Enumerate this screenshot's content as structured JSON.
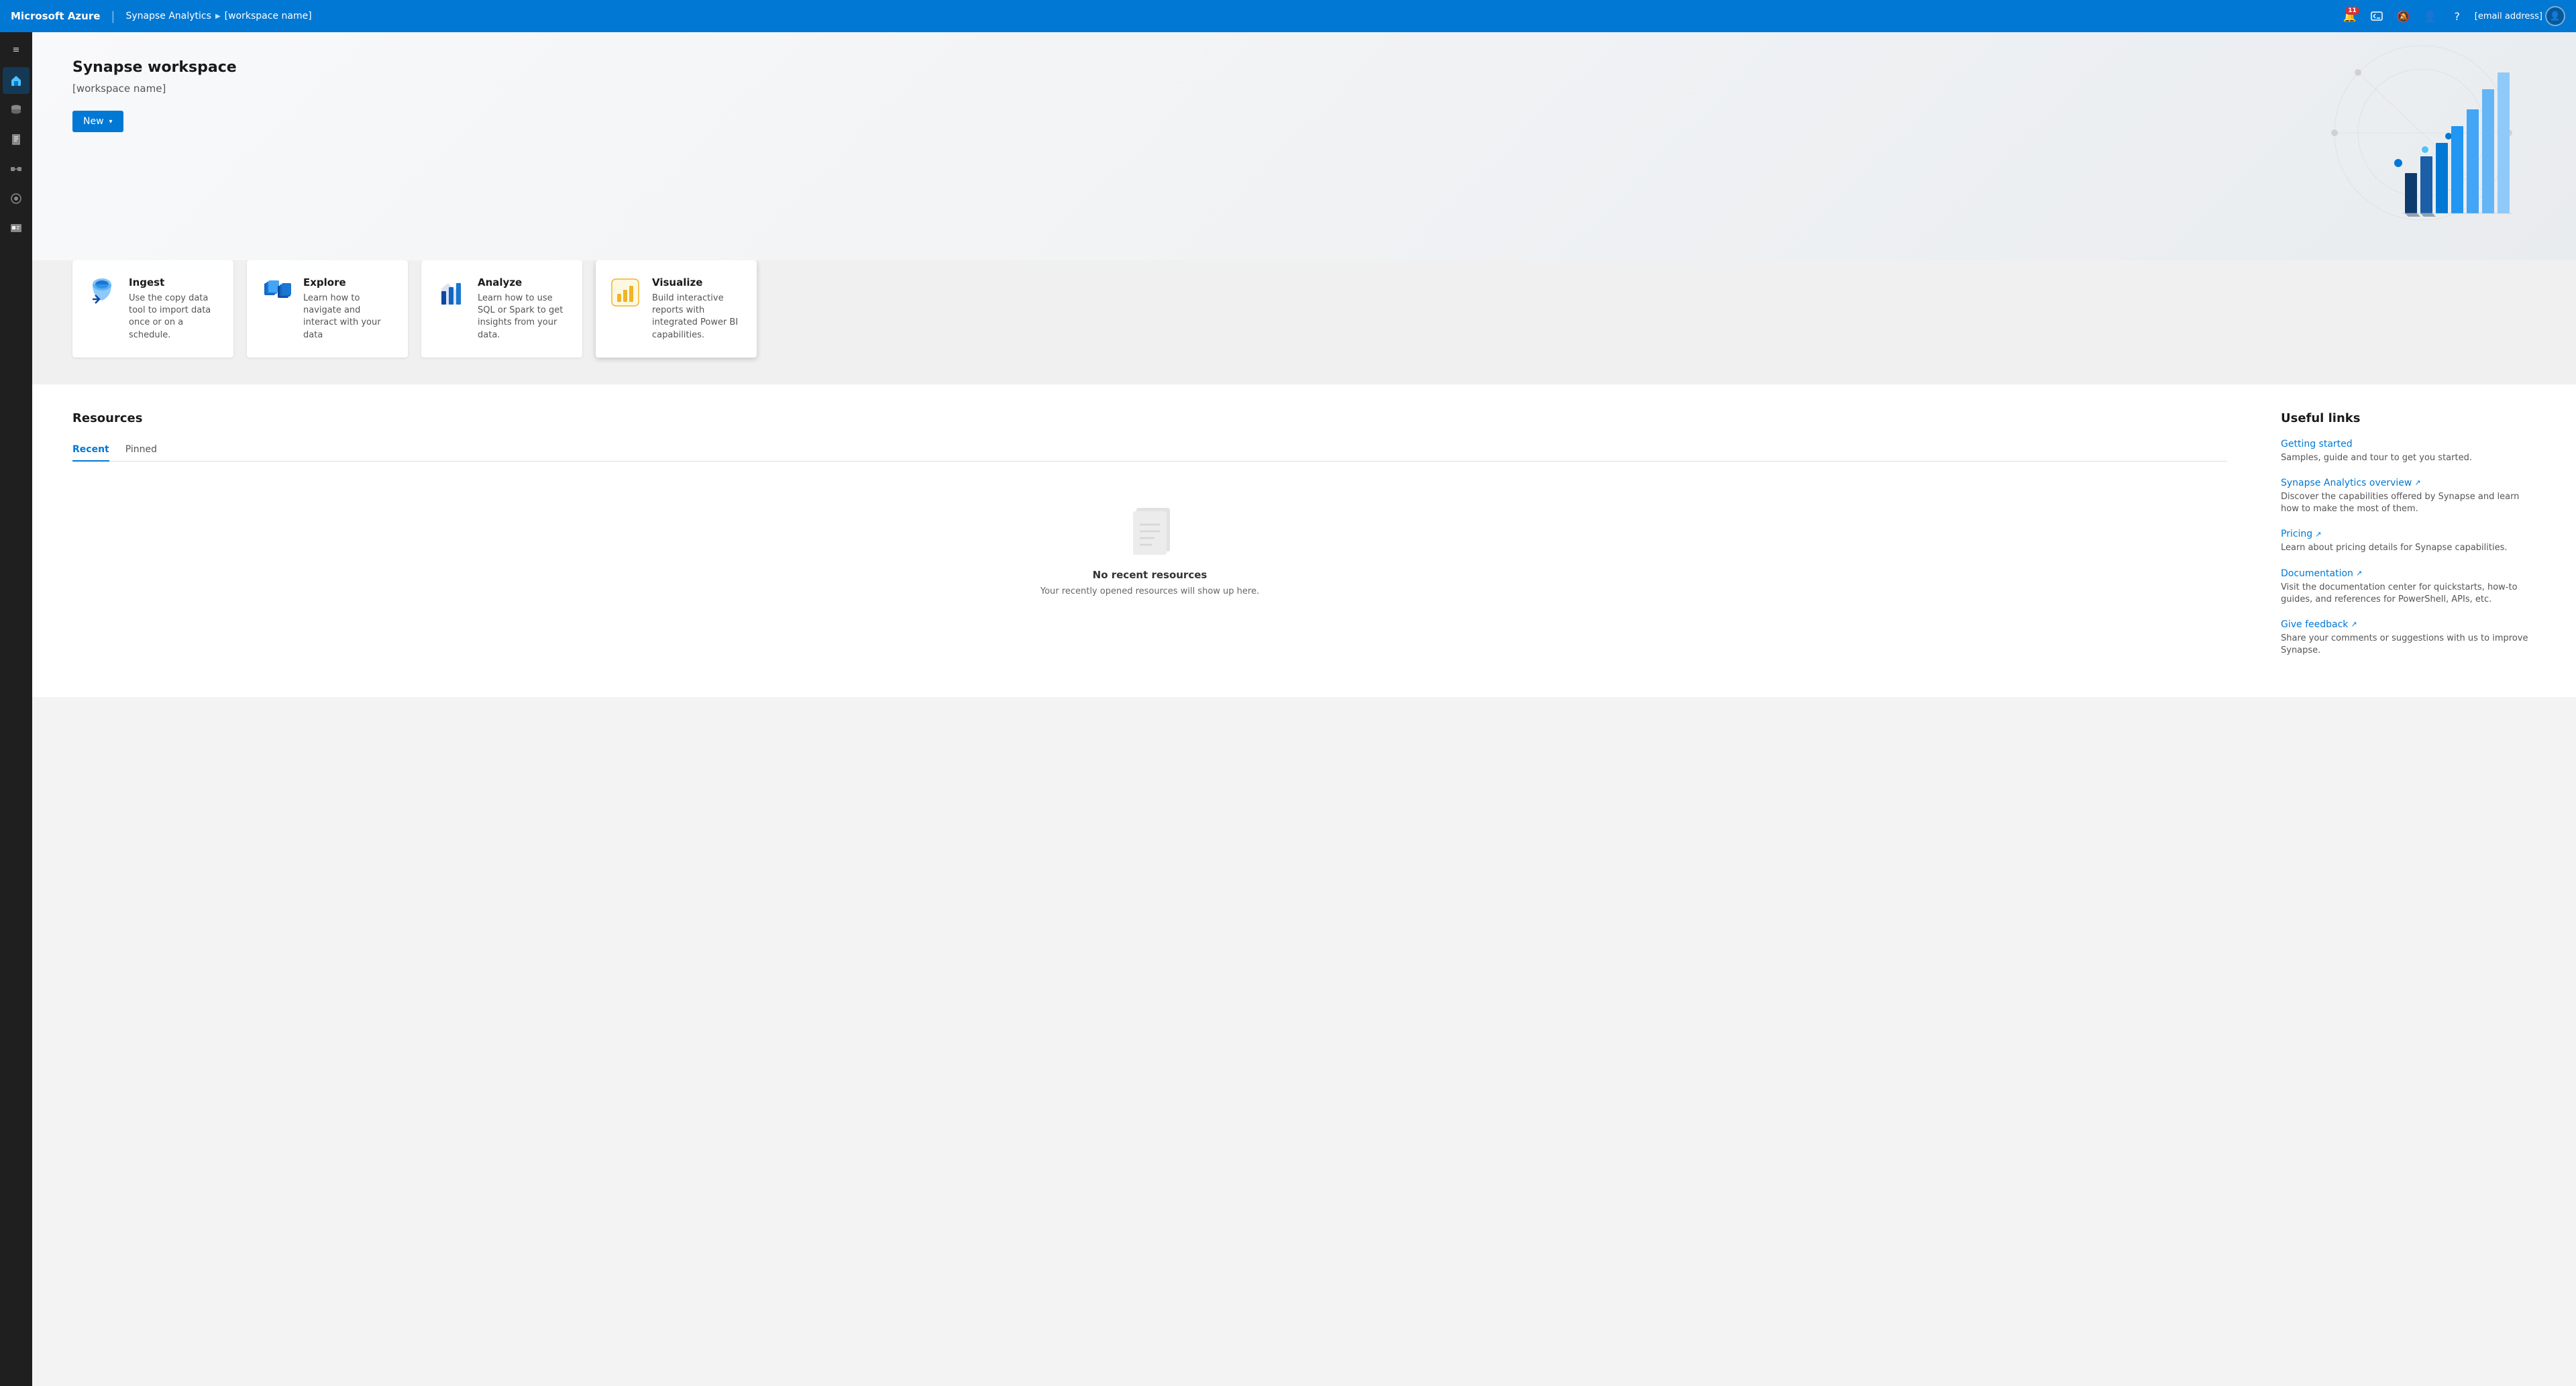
{
  "topbar": {
    "brand": "Microsoft Azure",
    "service": "Synapse Analytics",
    "workspace": "[workspace name]",
    "notification_count": "11",
    "email": "[email address]"
  },
  "sidebar": {
    "toggle_icon": "≡",
    "items": [
      {
        "id": "home",
        "icon": "⌂",
        "active": true
      },
      {
        "id": "database",
        "icon": "🗄"
      },
      {
        "id": "document",
        "icon": "📄"
      },
      {
        "id": "layers",
        "icon": "⧉"
      },
      {
        "id": "monitor",
        "icon": "◎"
      },
      {
        "id": "briefcase",
        "icon": "💼"
      }
    ]
  },
  "hero": {
    "title": "Synapse workspace",
    "workspace_name": "[workspace name]",
    "new_button": "New"
  },
  "cards": [
    {
      "id": "ingest",
      "title": "Ingest",
      "description": "Use the copy data tool to import data once or on a schedule.",
      "color": "#0078d4"
    },
    {
      "id": "explore",
      "title": "Explore",
      "description": "Learn how to navigate and interact with your data",
      "color": "#0078d4"
    },
    {
      "id": "analyze",
      "title": "Analyze",
      "description": "Learn how to use SQL or Spark to get insights from your data.",
      "color": "#0078d4"
    },
    {
      "id": "visualize",
      "title": "Visualize",
      "description": "Build interactive reports with integrated Power BI capabilities.",
      "color": "#f0b429",
      "highlighted": true
    }
  ],
  "resources": {
    "title": "Resources",
    "tabs": [
      {
        "id": "recent",
        "label": "Recent",
        "active": true
      },
      {
        "id": "pinned",
        "label": "Pinned",
        "active": false
      }
    ],
    "empty_title": "No recent resources",
    "empty_desc": "Your recently opened resources will show up here."
  },
  "useful_links": {
    "title": "Useful links",
    "links": [
      {
        "id": "getting-started",
        "label": "Getting started",
        "external": false,
        "description": "Samples, guide and tour to get you started."
      },
      {
        "id": "synapse-overview",
        "label": "Synapse Analytics overview",
        "external": true,
        "description": "Discover the capabilities offered by Synapse and learn how to make the most of them."
      },
      {
        "id": "pricing",
        "label": "Pricing",
        "external": true,
        "description": "Learn about pricing details for Synapse capabilities."
      },
      {
        "id": "documentation",
        "label": "Documentation",
        "external": true,
        "description": "Visit the documentation center for quickstarts, how-to guides, and references for PowerShell, APIs, etc."
      },
      {
        "id": "give-feedback",
        "label": "Give feedback",
        "external": true,
        "description": "Share your comments or suggestions with us to improve Synapse."
      }
    ]
  }
}
